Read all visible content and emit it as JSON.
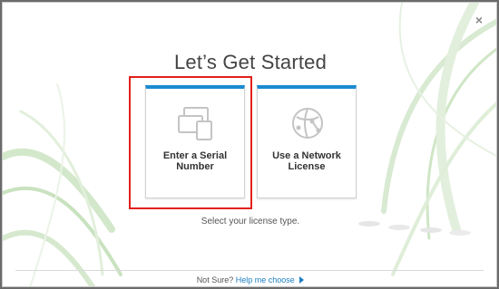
{
  "dialog": {
    "title": "Let’s Get Started",
    "subtitle": "Select your license type.",
    "close_glyph": "×"
  },
  "options": [
    {
      "label_line1": "Enter a Serial",
      "label_line2": "Number",
      "icon": "devices-icon",
      "selected": true
    },
    {
      "label_line1": "Use a Network",
      "label_line2": "License",
      "icon": "globe-network-icon",
      "selected": false
    }
  ],
  "footer": {
    "prefix": "Not Sure?",
    "link_label": "Help me choose"
  },
  "colors": {
    "accent": "#1b8bd1",
    "highlight": "#e2211c",
    "link": "#1f7fc4"
  }
}
